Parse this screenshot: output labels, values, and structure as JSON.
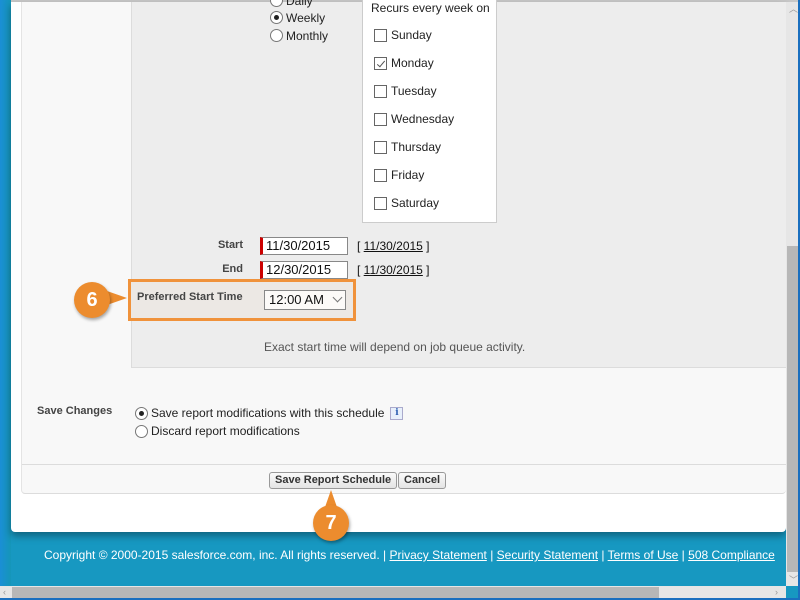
{
  "frequency": {
    "options": [
      {
        "label": "Daily",
        "selected": false
      },
      {
        "label": "Weekly",
        "selected": true
      },
      {
        "label": "Monthly",
        "selected": false
      }
    ]
  },
  "weekly": {
    "title": "Recurs every week on",
    "days": [
      {
        "label": "Sunday",
        "checked": false
      },
      {
        "label": "Monday",
        "checked": true
      },
      {
        "label": "Tuesday",
        "checked": false
      },
      {
        "label": "Wednesday",
        "checked": false
      },
      {
        "label": "Thursday",
        "checked": false
      },
      {
        "label": "Friday",
        "checked": false
      },
      {
        "label": "Saturday",
        "checked": false
      }
    ]
  },
  "dates": {
    "start_label": "Start",
    "start_value": "11/30/2015",
    "start_link": "11/30/2015",
    "end_label": "End",
    "end_value": "12/30/2015",
    "end_link": "11/30/2015"
  },
  "time": {
    "label": "Preferred Start Time",
    "value": "12:00 AM",
    "note": "Exact start time will depend on job queue activity."
  },
  "save_changes": {
    "label": "Save Changes",
    "options": [
      {
        "label": "Save report modifications with this schedule",
        "selected": true
      },
      {
        "label": "Discard report modifications",
        "selected": false
      }
    ],
    "info_icon": "i"
  },
  "buttons": {
    "save": "Save Report Schedule",
    "cancel": "Cancel"
  },
  "callouts": {
    "step6": "6",
    "step7": "7",
    "color": "#ec8c2e"
  },
  "footer": {
    "copyright": "Copyright © 2000-2015 salesforce.com, inc. All rights reserved. |",
    "links": [
      "Privacy Statement",
      "Security Statement",
      "Terms of Use",
      "508 Compliance"
    ],
    "sep": "|"
  }
}
